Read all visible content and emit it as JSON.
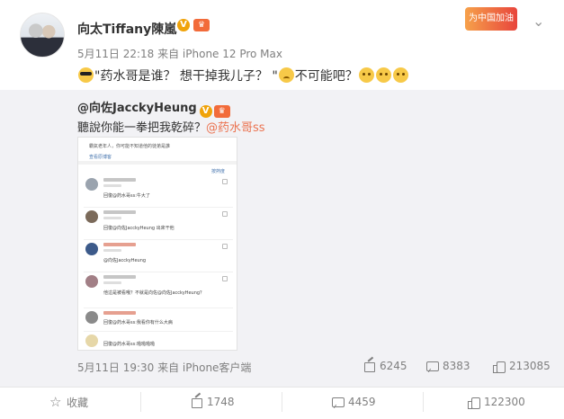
{
  "post": {
    "username": "向太Tiffany陳嵐",
    "verified_mark": "V",
    "meta": "5月11日 22:18 来自 iPhone 12 Pro Max",
    "text_parts": [
      "\"药水哥是谁？ 想干掉我儿子？ \"",
      "不可能吧？"
    ],
    "promo_badge": "为中国加油",
    "more_icon": "⌄"
  },
  "repost": {
    "username": "@向佐JacckyHeung",
    "verified_mark": "V",
    "text": "聽說你能一拳把我乾碎？",
    "mention": "@药水哥ss",
    "meta": "5月11日 19:30 来自 iPhone客户端",
    "reposts": "6245",
    "comments": "8383",
    "likes": "213085",
    "screenshot": {
      "header": "霸氣老年人，你可能不知道他的徒弟是誰",
      "header_link": "查看原博客",
      "sort_label": "按熱度",
      "comments": [
        {
          "text": "回復@药水哥ss:牛大了"
        },
        {
          "text": "回復@向佐JacckyHeung 出來干他"
        },
        {
          "text": "@向佐JacckyHeung"
        },
        {
          "text": "他這是被看哦？不就是向佐@向佐JacckyHeung？"
        },
        {
          "text": "回復@药水哥ss:我看你有什么大病"
        },
        {
          "text": "回復@药水哥ss:啪啪啪啪"
        }
      ]
    }
  },
  "footer": {
    "favorite_label": "收藏",
    "reposts": "1748",
    "comments": "4459",
    "likes": "122300"
  },
  "colors": {
    "accent": "#eb7350",
    "repost_bg": "#f2f2f5",
    "meta_text": "#808080"
  }
}
